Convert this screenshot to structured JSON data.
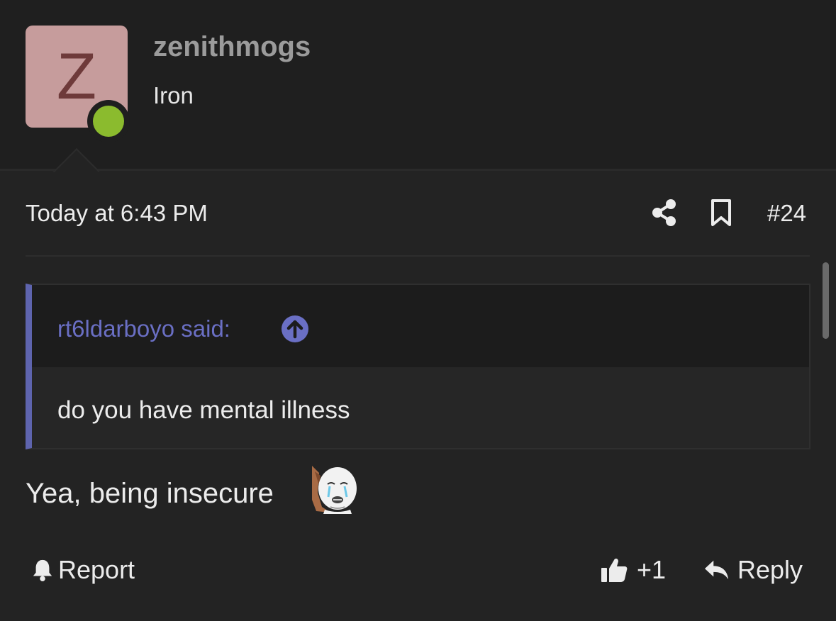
{
  "author": {
    "avatar_letter": "Z",
    "username": "zenithmogs",
    "user_title": "Iron",
    "online": true,
    "avatar_color": "#c69c9c",
    "online_color": "#8bbb2e"
  },
  "post": {
    "date": "Today at 6:43 PM",
    "number": "#24"
  },
  "quote": {
    "author_line": "rt6ldarboyo said:",
    "text": "do you have mental illness",
    "accent_color": "#5e64ae"
  },
  "message": {
    "text": "Yea, being insecure",
    "emoji": "crying-wojak-emoji"
  },
  "actions": {
    "report_label": "Report",
    "like_count": "+1",
    "reply_label": "Reply"
  },
  "icons": {
    "share": "share-icon",
    "bookmark": "bookmark-icon",
    "jump": "arrow-up-circle-icon",
    "report": "bell-icon",
    "like": "thumbs-up-icon",
    "reply": "reply-icon"
  }
}
